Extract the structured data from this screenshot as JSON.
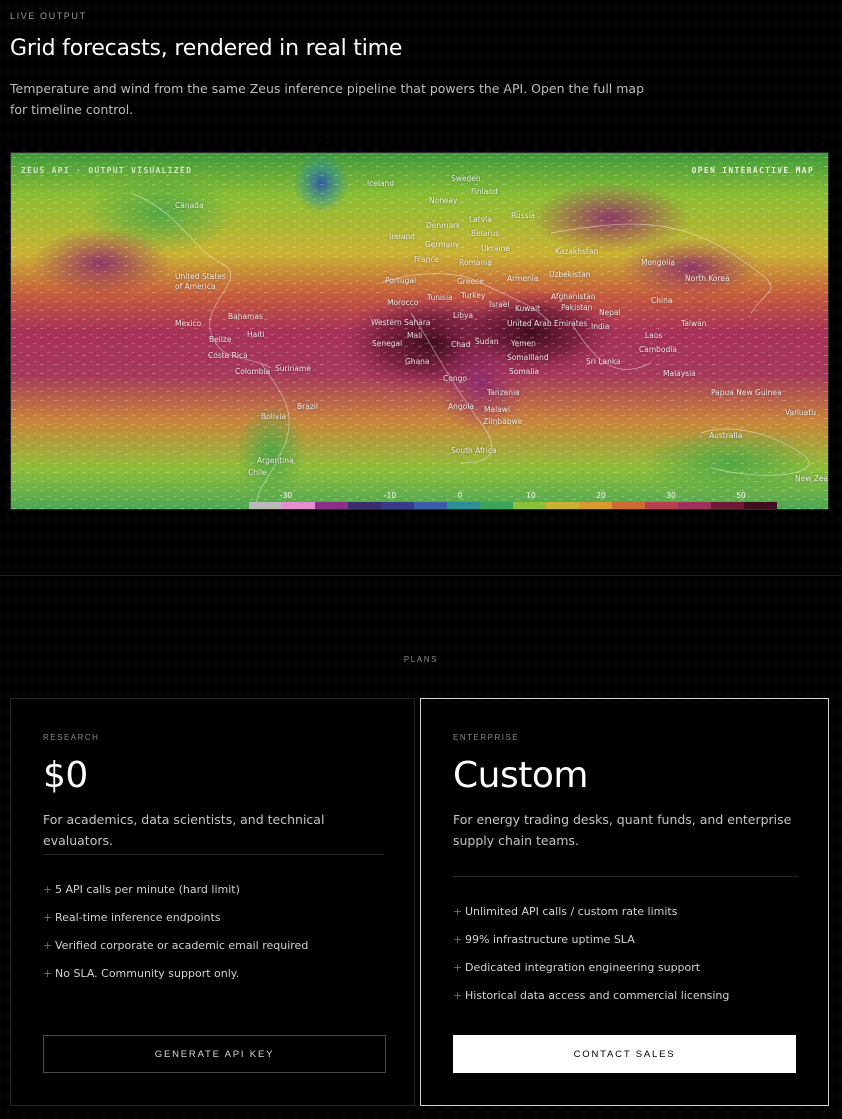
{
  "section": {
    "eyebrow": "LIVE OUTPUT",
    "title": "Grid forecasts, rendered in real time",
    "description": "Temperature and wind from the same Zeus inference pipeline that powers the API. Open the full map for timeline control."
  },
  "map": {
    "caption": "ZEUS API · OUTPUT VISUALIZED",
    "open_link": "OPEN INTERACTIVE MAP",
    "countries": [
      "Iceland",
      "Sweden",
      "Finland",
      "Norway",
      "Russia",
      "Latvia",
      "Denmark",
      "Belarus",
      "Ireland",
      "Germany",
      "Ukraine",
      "Kazakhstan",
      "Mongolia",
      "France",
      "Romania",
      "Uzbekistan",
      "Canada",
      "United States of America",
      "Portugal",
      "Greece",
      "Armenia",
      "North Korea",
      "Turkey",
      "Afghanistan",
      "China",
      "Morocco",
      "Tunisia",
      "Israel",
      "Pakistan",
      "Kuwait",
      "Nepal",
      "Libya",
      "United Arab Emirates",
      "India",
      "Taiwan",
      "Mexico",
      "Bahamas",
      "Western Sahara",
      "Haiti",
      "Mali",
      "Chad",
      "Sudan",
      "Yemen",
      "Laos",
      "Belize",
      "Costa Rica",
      "Senegal",
      "Cambodia",
      "Somaliland",
      "Ghana",
      "Colombia",
      "Suriname",
      "Sri Lanka",
      "Somalia",
      "Malaysia",
      "Congo",
      "Tanzania",
      "Papua New Guinea",
      "Vanuatu",
      "Brazil",
      "Angola",
      "Malawi",
      "Bolivia",
      "Zimbabwe",
      "Australia",
      "Argentina",
      "South Africa",
      "New Zealand",
      "Chile"
    ],
    "color_scale": {
      "labels": [
        "-30",
        "-10",
        "0",
        "10",
        "20",
        "30",
        "50"
      ],
      "colors": [
        "#b9b9b9",
        "#e48fce",
        "#8a2f8a",
        "#3a2d6e",
        "#3a3c8a",
        "#3c5ea8",
        "#2f8f99",
        "#3aa35a",
        "#8cbf3a",
        "#c9b232",
        "#d79a30",
        "#cf6a33",
        "#b8404f",
        "#a0305e",
        "#6e1a36",
        "#3f0e1f"
      ]
    }
  },
  "plans": {
    "label": "PLANS",
    "research": {
      "tier": "RESEARCH",
      "price": "$0",
      "description": "For academics, data scientists, and technical evaluators.",
      "features": [
        "5 API calls per minute (hard limit)",
        "Real-time inference endpoints",
        "Verified corporate or academic email required",
        "No SLA. Community support only."
      ],
      "cta": "GENERATE API KEY"
    },
    "enterprise": {
      "tier": "ENTERPRISE",
      "price": "Custom",
      "description": "For energy trading desks, quant funds, and enterprise supply chain teams.",
      "features": [
        "Unlimited API calls / custom rate limits",
        "99% infrastructure uptime SLA",
        "Dedicated integration engineering support",
        "Historical data access and commercial licensing"
      ],
      "cta": "CONTACT SALES"
    }
  }
}
